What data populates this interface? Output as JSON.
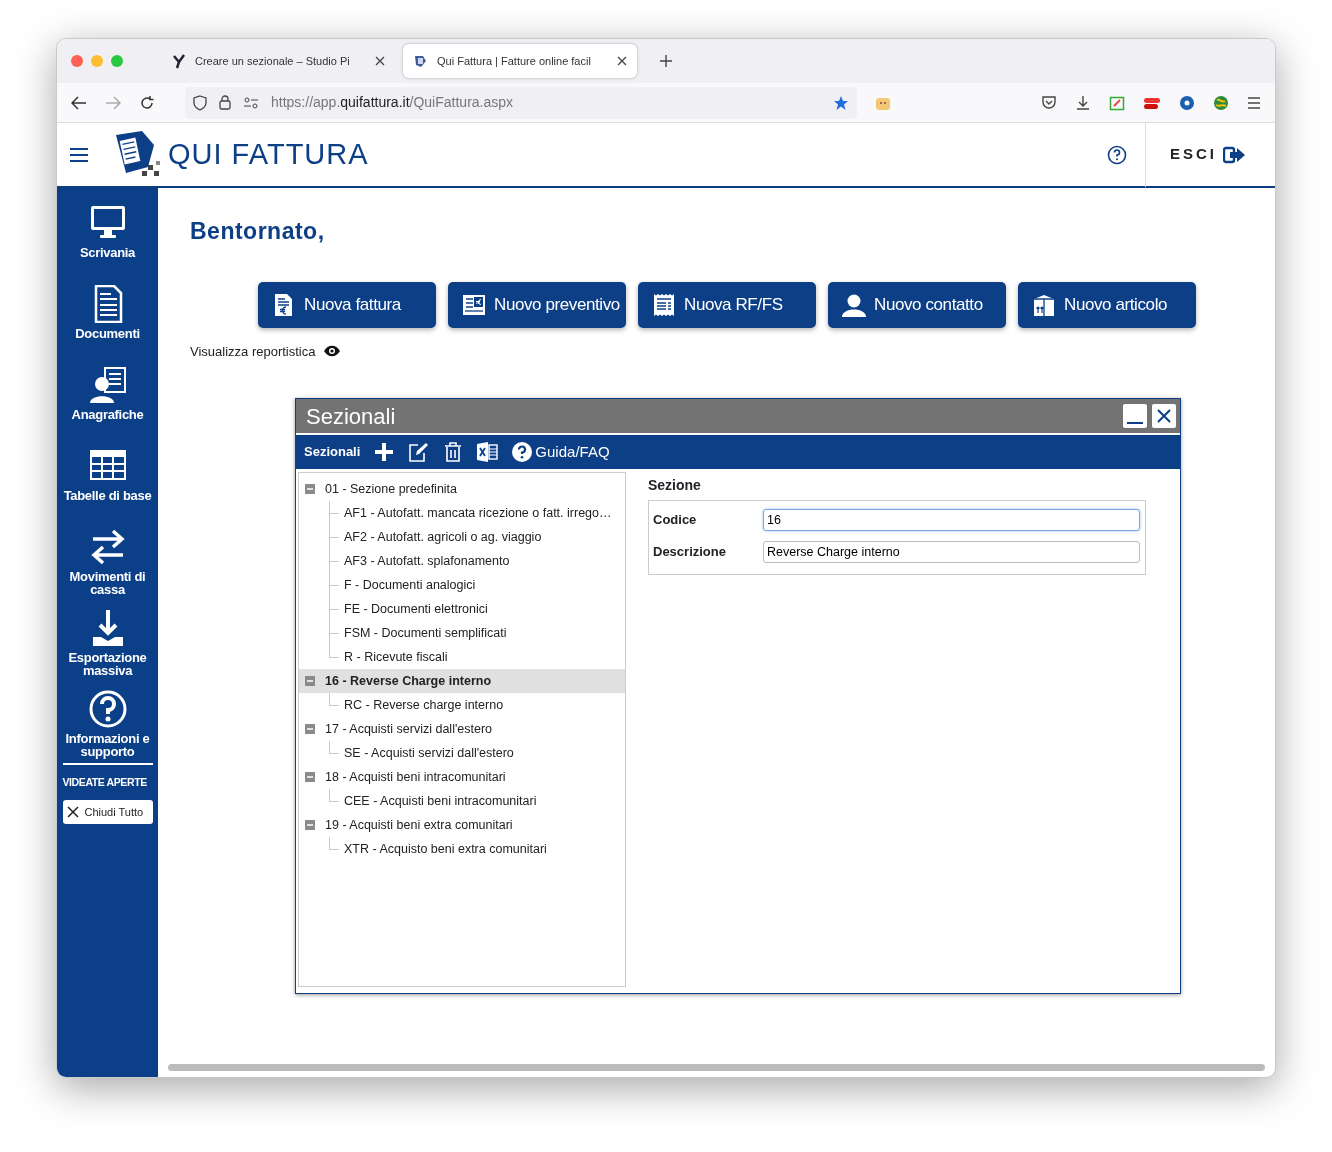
{
  "browser": {
    "tabs": [
      {
        "title": "Creare un sezionale – Studio Pi",
        "selected": false
      },
      {
        "title": "Qui Fattura | Fatture online facil",
        "selected": true
      }
    ],
    "url": {
      "scheme": "https://app.",
      "domain": "quifattura.it",
      "path": "/QuiFattura.aspx"
    }
  },
  "header": {
    "logo_text": "QUI FATTURA",
    "logout": "ESCI"
  },
  "sidebar": {
    "items": [
      {
        "label": "Scrivania"
      },
      {
        "label": "Documenti"
      },
      {
        "label": "Anagrafiche"
      },
      {
        "label": "Tabelle di base"
      },
      {
        "label": "Movimenti di cassa"
      },
      {
        "label": "Esportazione massiva"
      },
      {
        "label": "Informazioni e supporto"
      }
    ],
    "open_windows": "VIDEATE APERTE",
    "close_all": "Chiudi Tutto"
  },
  "greeting": "Bentornato,",
  "quick_actions": [
    "Nuova fattura",
    "Nuovo preventivo",
    "Nuova RF/FS",
    "Nuovo contatto",
    "Nuovo articolo"
  ],
  "report_link": "Visualizza reportistica",
  "dialog": {
    "title": "Sezionali",
    "toolbar_label": "Sezionali",
    "help": "Guida/FAQ",
    "tree": [
      {
        "label": "01 - Sezione predefinita",
        "expanded": true,
        "selected": false,
        "children": [
          {
            "label": "AF1 - Autofatt. mancata ricezione o fatt. irrego…",
            "selected": false
          },
          {
            "label": "AF2 - Autofatt. agricoli o ag. viaggio",
            "selected": false
          },
          {
            "label": "AF3 - Autofatt. splafonamento",
            "selected": false
          },
          {
            "label": "F - Documenti analogici",
            "selected": false
          },
          {
            "label": "FE - Documenti elettronici",
            "selected": false
          },
          {
            "label": "FSM - Documenti semplificati",
            "selected": false
          },
          {
            "label": "R - Ricevute fiscali",
            "selected": false
          }
        ]
      },
      {
        "label": "16 - Reverse Charge interno",
        "expanded": true,
        "selected": true,
        "children": [
          {
            "label": "RC - Reverse charge interno",
            "selected": false
          }
        ]
      },
      {
        "label": "17 - Acquisti servizi dall'estero",
        "expanded": true,
        "selected": false,
        "children": [
          {
            "label": "SE - Acquisti servizi dall'estero",
            "selected": false
          }
        ]
      },
      {
        "label": "18 - Acquisti beni intracomunitari",
        "expanded": true,
        "selected": false,
        "children": [
          {
            "label": "CEE - Acquisti beni intracomunitari",
            "selected": false
          }
        ]
      },
      {
        "label": "19 - Acquisti beni extra comunitari",
        "expanded": true,
        "selected": false,
        "children": [
          {
            "label": "XTR - Acquisto beni extra comunitari",
            "selected": false
          }
        ]
      }
    ],
    "form": {
      "heading": "Sezione",
      "fields": [
        {
          "label": "Codice",
          "value": "16",
          "focused": true
        },
        {
          "label": "Descrizione",
          "value": "Reverse Charge interno",
          "focused": false
        }
      ]
    }
  }
}
